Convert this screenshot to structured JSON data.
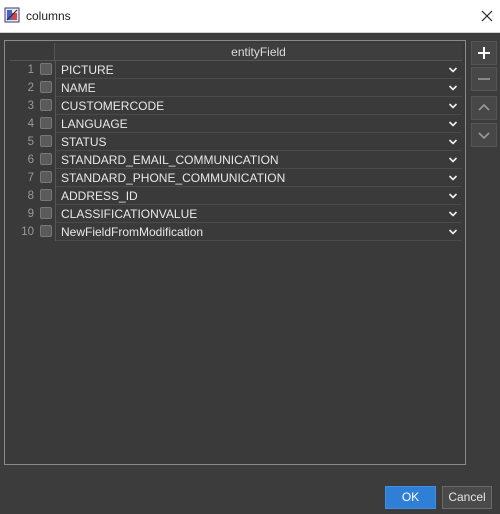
{
  "window": {
    "title": "columns",
    "app_icon": "editor-window-icon",
    "close_icon": "close-icon"
  },
  "table": {
    "column_header": "entityField",
    "rows": [
      {
        "num": "1",
        "value": "PICTURE"
      },
      {
        "num": "2",
        "value": "NAME"
      },
      {
        "num": "3",
        "value": "CUSTOMERCODE"
      },
      {
        "num": "4",
        "value": "LANGUAGE"
      },
      {
        "num": "5",
        "value": "STATUS"
      },
      {
        "num": "6",
        "value": "STANDARD_EMAIL_COMMUNICATION"
      },
      {
        "num": "7",
        "value": "STANDARD_PHONE_COMMUNICATION"
      },
      {
        "num": "8",
        "value": "ADDRESS_ID"
      },
      {
        "num": "9",
        "value": "CLASSIFICATIONVALUE"
      },
      {
        "num": "10",
        "value": "NewFieldFromModification"
      }
    ]
  },
  "side_buttons": [
    {
      "icon": "plus-icon"
    },
    {
      "icon": "minus-icon"
    },
    {
      "icon": "chevron-up-icon"
    },
    {
      "icon": "chevron-down-icon"
    }
  ],
  "footer": {
    "ok_label": "OK",
    "cancel_label": "Cancel"
  },
  "colors": {
    "background": "#3c3c3c",
    "accent": "#2f7fd6",
    "titlebar": "#ffffff"
  }
}
